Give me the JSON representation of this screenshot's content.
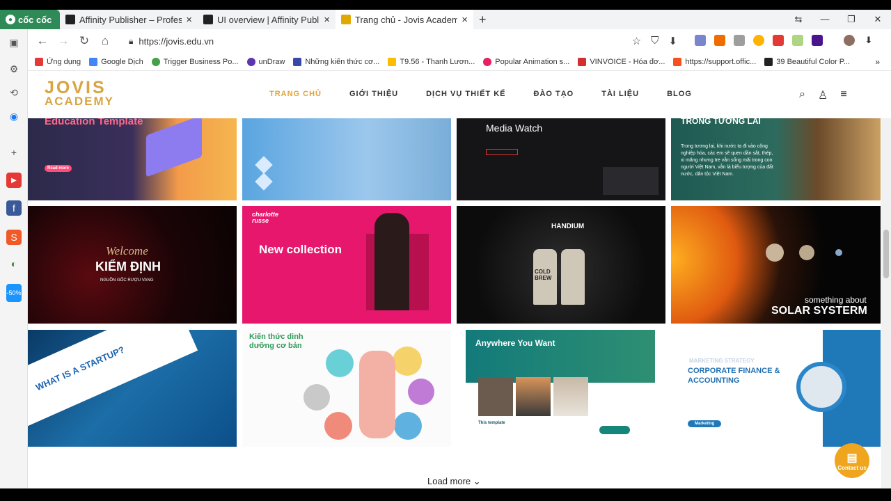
{
  "browser": {
    "brand": "cốc cốc",
    "tabs": [
      {
        "title": "Affinity Publisher – Professio"
      },
      {
        "title": "UI overview | Affinity Publishe"
      },
      {
        "title": "Trang chủ - Jovis Academy"
      }
    ],
    "url": "https://jovis.edu.vn",
    "bookmarks": [
      {
        "label": "Ứng dụng",
        "color": "#e53935"
      },
      {
        "label": "Google Dịch",
        "color": "#4285f4"
      },
      {
        "label": "Trigger Business Po...",
        "color": "#43a047"
      },
      {
        "label": "unDraw",
        "color": "#5e35b1"
      },
      {
        "label": "Những kiến thức cơ...",
        "color": "#3949ab"
      },
      {
        "label": "T9.56 - Thanh Lươn...",
        "color": "#fbbc04"
      },
      {
        "label": "Popular Animation s...",
        "color": "#e91e63"
      },
      {
        "label": "VINVOICE - Hóa đơ...",
        "color": "#d32f2f"
      },
      {
        "label": "https://support.offic...",
        "color": "#f4511e"
      },
      {
        "label": "39 Beautiful Color P...",
        "color": "#222222"
      }
    ]
  },
  "site": {
    "logo_line1": "JOVIS",
    "logo_line2": "ACADEMY",
    "menu": [
      {
        "label": "TRANG CHỦ"
      },
      {
        "label": "GIỚI THIỆU"
      },
      {
        "label": "DỊCH VỤ THIẾT KẾ"
      },
      {
        "label": "ĐÀO TẠO"
      },
      {
        "label": "TÀI LIỆU"
      },
      {
        "label": "BLOG"
      }
    ],
    "cards": {
      "c1": "Education Template",
      "c1b": "Read more",
      "c3": "Media Watch",
      "c4": "TRONG TƯƠNG LAI",
      "c4b": "Trong tương lai, khi nước ta đi vào công nghiệp hóa, các em sẽ quen dần sắt, thép, xi măng nhưng tre vẫn sống mãi trong con người Việt Nam, vẫn là biểu tượng của đất nước, dân tộc Việt Nam.",
      "c5a": "Welcome",
      "c5b": "KIỂM ĐỊNH",
      "c5c": "NGUỒN GỐC RƯỢU VANG",
      "c6a": "charlotte russe",
      "c6b": "New collection",
      "c7": "HANDIUM",
      "c7b": "COLD BREW",
      "c8a": "something about",
      "c8b": "SOLAR SYSTERM",
      "c9": "WHAT IS A STARTUP?",
      "c10": "Kiến thức dinh dưỡng cơ bản",
      "c11": "Anywhere You Want",
      "c11b": "This template",
      "c12a": "MARKETING STRATEGY",
      "c12b": "CORPORATE FINANCE & ACCOUNTING",
      "c12c": "Marketing"
    },
    "load_more": "Load more",
    "contact": "Contact us"
  }
}
